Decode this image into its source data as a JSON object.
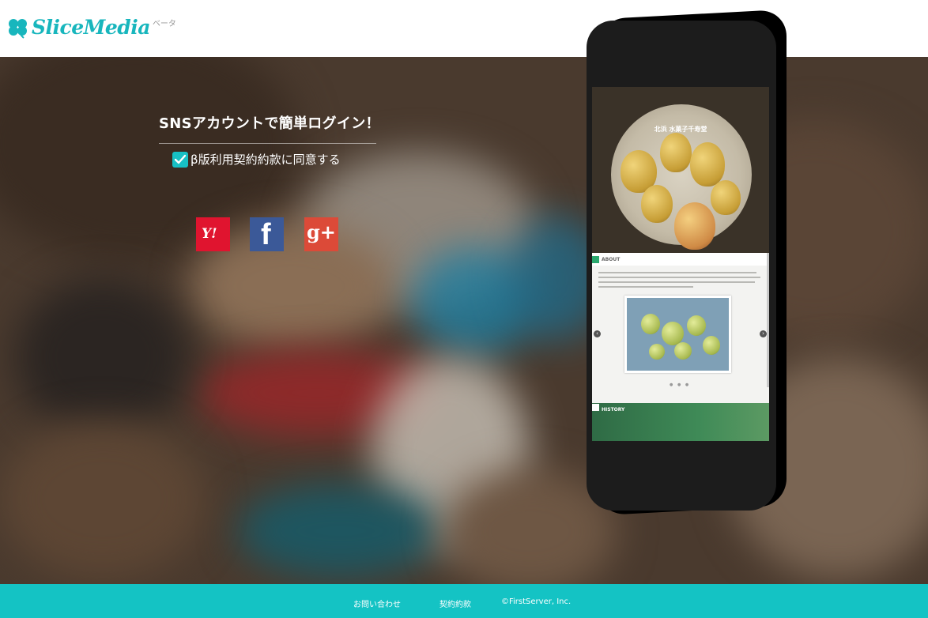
{
  "header": {
    "logo_text": "SliceMedia",
    "logo_sub": "ベータ"
  },
  "login": {
    "title": "SNSアカウントで簡単ログイン！",
    "agree_label": "β版利用契約約款に同意する",
    "agree_checked": true,
    "providers": [
      {
        "name": "Yahoo",
        "icon": "yahoo-icon",
        "glyph": "Y!",
        "color": "#e0142f"
      },
      {
        "name": "Facebook",
        "icon": "facebook-icon",
        "glyph": "f",
        "color": "#3b5998"
      },
      {
        "name": "Google+",
        "icon": "google-plus-icon",
        "glyph": "g+",
        "color": "#dc4a38"
      }
    ]
  },
  "phone_screen": {
    "hero_title": "北浜 水菓子千寿堂",
    "about_label": "ABOUT",
    "history_label": "HISTORY"
  },
  "footer": {
    "contact": "お問い合わせ",
    "terms": "契約約款",
    "copyright": "©FirstServer, Inc."
  },
  "colors": {
    "accent": "#14c3c4",
    "checkbox": "#17c0c4",
    "logo": "#18b6bd"
  }
}
